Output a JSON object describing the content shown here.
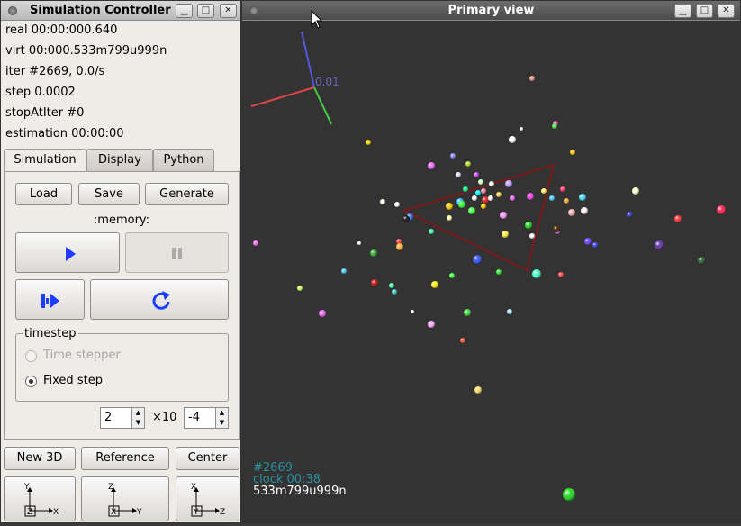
{
  "sim": {
    "title": "Simulation Controller",
    "real": "real 00:00:000.640",
    "virt": "virt 00:000.533m799u999n",
    "iter": "iter #2669, 0.0/s",
    "step": "step 0.0002",
    "stop": "stopAtIter #0",
    "estimation": "estimation 00:00:00",
    "tabs": [
      "Simulation",
      "Display",
      "Python"
    ],
    "load": "Load",
    "save": "Save",
    "generate": "Generate",
    "memory": ":memory:",
    "timestep_label": "timestep",
    "time_stepper": "Time stepper",
    "fixed_step": "Fixed step",
    "mantissa": "2",
    "times10": "×10",
    "exponent": "-4",
    "new3d": "New 3D",
    "reference": "Reference",
    "center": "Center",
    "axes": [
      [
        "Y",
        "Z",
        "X"
      ],
      [
        "Z",
        "X",
        "Y"
      ],
      [
        "X",
        "Y",
        "Z"
      ]
    ]
  },
  "view": {
    "title": "Primary view",
    "axis_scale": "0.01",
    "overlay_iter": "#2669",
    "overlay_clock": "clock 00:38",
    "overlay_virt": "533m799u999n"
  },
  "colors": {
    "accent": "#1a3dff",
    "bg_view": "#333333",
    "frame": "#7a1a1a"
  }
}
